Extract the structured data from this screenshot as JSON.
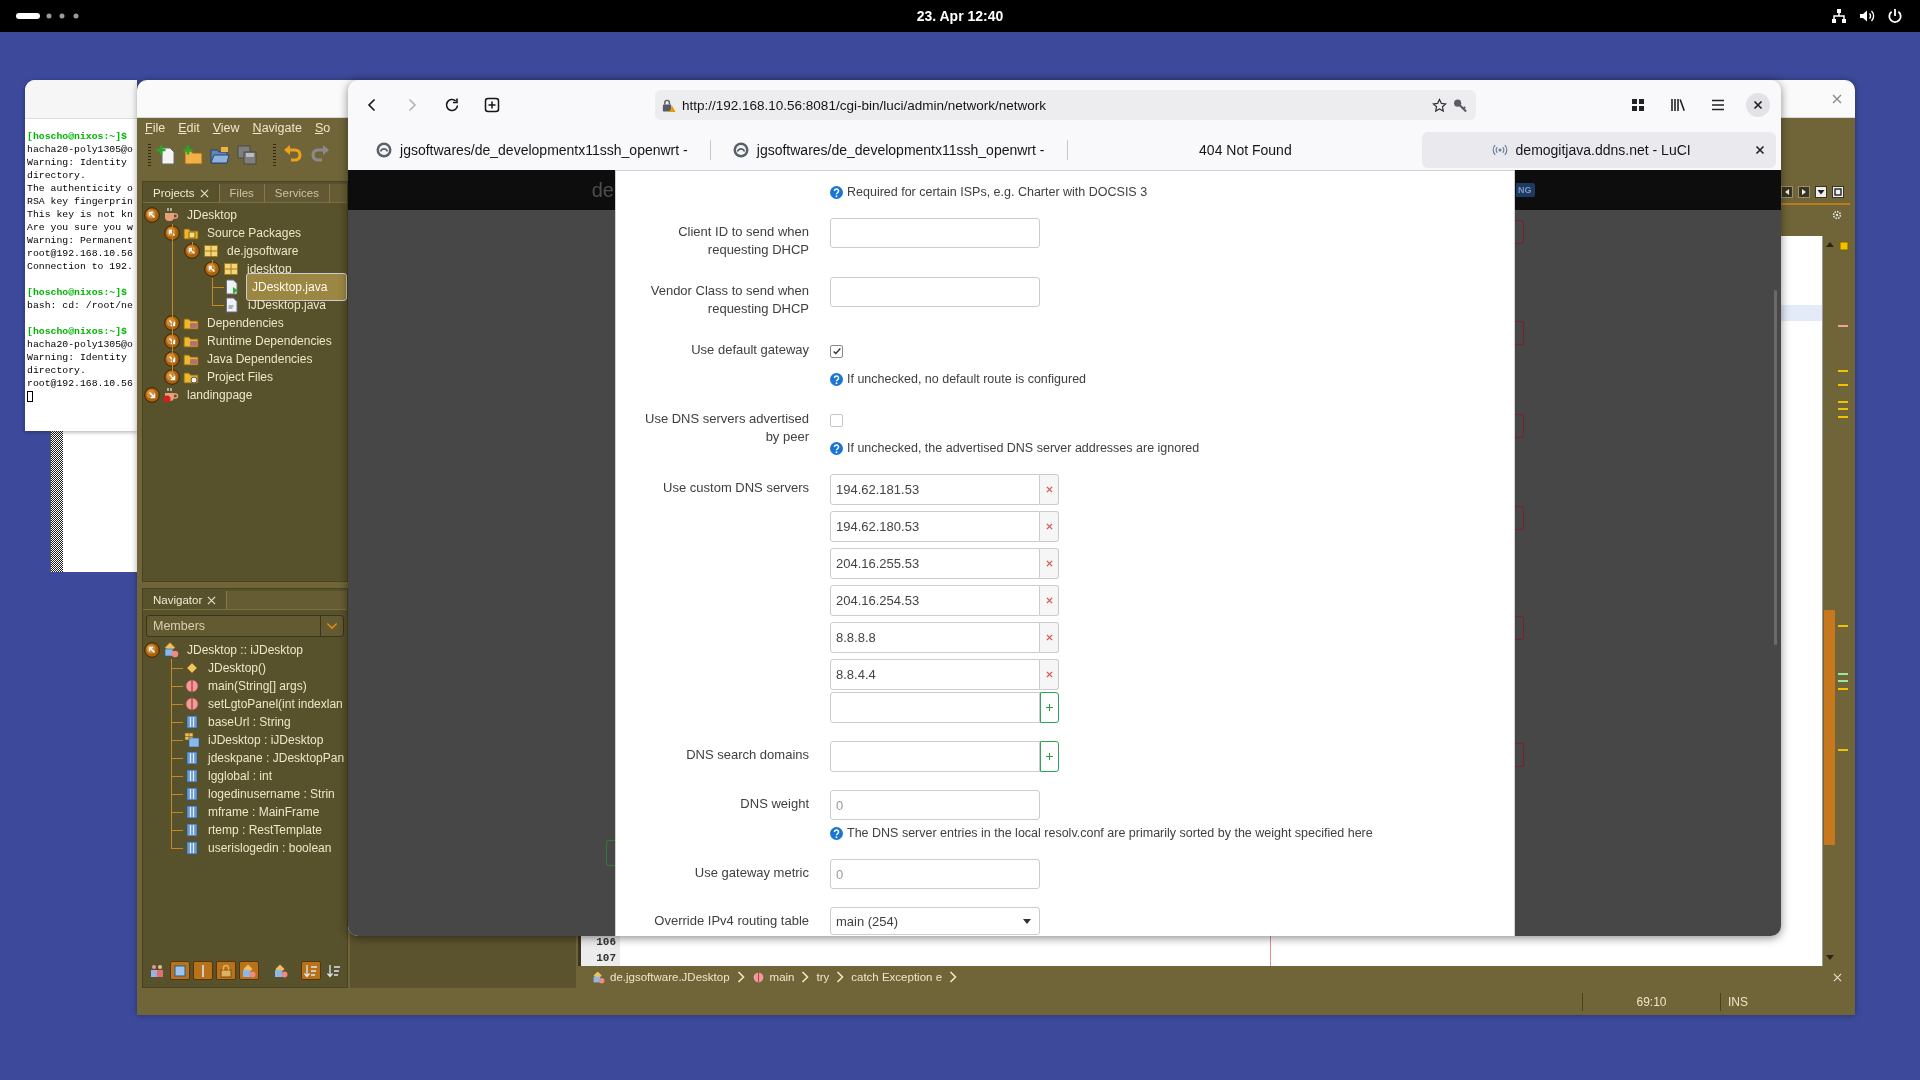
{
  "top_bar": {
    "clock": "23. Apr 12:40"
  },
  "terminal": {
    "lines": [
      {
        "kind": "prompt",
        "text": "[hoscho@nixos:~]$"
      },
      {
        "kind": "output",
        "text": "hacha20-poly1305@o"
      },
      {
        "kind": "output",
        "text": "Warning: Identity"
      },
      {
        "kind": "output",
        "text": "directory."
      },
      {
        "kind": "output",
        "text": "The authenticity o"
      },
      {
        "kind": "output",
        "text": "RSA key fingerprin"
      },
      {
        "kind": "output",
        "text": "This key is not kn"
      },
      {
        "kind": "output",
        "text": "Are you sure you w"
      },
      {
        "kind": "output",
        "text": "Warning: Permanent"
      },
      {
        "kind": "output",
        "text": "root@192.168.10.56"
      },
      {
        "kind": "output",
        "text": "Connection to 192."
      },
      {
        "kind": "blank"
      },
      {
        "kind": "prompt",
        "text": "[hoscho@nixos:~]$"
      },
      {
        "kind": "output",
        "text": "bash: cd: /root/ne"
      },
      {
        "kind": "blank"
      },
      {
        "kind": "prompt",
        "text": "[hoscho@nixos:~]$"
      },
      {
        "kind": "output",
        "text": "hacha20-poly1305@o"
      },
      {
        "kind": "output",
        "text": "Warning: Identity"
      },
      {
        "kind": "output",
        "text": "directory."
      },
      {
        "kind": "output",
        "text": "root@192.168.10.56"
      },
      {
        "kind": "cursor"
      }
    ]
  },
  "netbeans": {
    "menu": [
      "File",
      "Edit",
      "View",
      "Navigate",
      "So"
    ],
    "toolbar": [
      {
        "kind": "new-file",
        "disabled": false
      },
      {
        "kind": "new-project",
        "disabled": false
      },
      {
        "kind": "open-project",
        "disabled": false
      },
      {
        "kind": "save-all",
        "disabled": true
      },
      {
        "kind": "undo",
        "disabled": false
      },
      {
        "kind": "redo",
        "disabled": true
      }
    ],
    "projects": {
      "tabs": [
        {
          "label": "Projects",
          "selected": true
        },
        {
          "label": "Files",
          "selected": false
        },
        {
          "label": "Services",
          "selected": false
        }
      ],
      "tree": [
        {
          "label": "JDesktop",
          "kind": "project",
          "expanded": true,
          "selected": false,
          "children": [
            {
              "label": "Source Packages",
              "kind": "source-folder",
              "expanded": true,
              "selected": false,
              "children": [
                {
                  "label": "de.jgsoftware",
                  "kind": "package",
                  "expanded": true,
                  "selected": false,
                  "children": [
                    {
                      "label": "jdesktop",
                      "kind": "package",
                      "expanded": true,
                      "selected": false,
                      "children": [
                        {
                          "label": "JDesktop.java",
                          "kind": "main-file",
                          "selected": true
                        },
                        {
                          "label": "iJDesktop.java",
                          "kind": "file",
                          "selected": false
                        }
                      ]
                    }
                  ]
                }
              ]
            },
            {
              "label": "Dependencies",
              "kind": "library",
              "expanded": false,
              "selected": false
            },
            {
              "label": "Runtime Dependencies",
              "kind": "library",
              "expanded": false,
              "selected": false
            },
            {
              "label": "Java Dependencies",
              "kind": "library",
              "expanded": false,
              "selected": false
            },
            {
              "label": "Project Files",
              "kind": "config-folder",
              "expanded": false,
              "selected": false
            }
          ]
        },
        {
          "label": "landingpage",
          "kind": "error-project",
          "expanded": false,
          "selected": false
        }
      ]
    },
    "navigator": {
      "title": "Navigator",
      "filter": "Members",
      "tree": [
        {
          "label": "JDesktop :: iJDesktop",
          "kind": "class",
          "expanded": true,
          "children": [
            {
              "label": "JDesktop()",
              "kind": "constructor"
            },
            {
              "label": "main(String[] args)",
              "kind": "method"
            },
            {
              "label": "setLgtoPanel(int indexlan",
              "kind": "method"
            },
            {
              "label": "baseUrl : String",
              "kind": "field"
            },
            {
              "label": "iJDesktop : iJDesktop",
              "kind": "inner-class"
            },
            {
              "label": "jdeskpane : JDesktopPan",
              "kind": "field"
            },
            {
              "label": "lgglobal : int",
              "kind": "field"
            },
            {
              "label": "logedinusername : Strin",
              "kind": "field"
            },
            {
              "label": "mframe : MainFrame",
              "kind": "field"
            },
            {
              "label": "rtemp : RestTemplate",
              "kind": "field"
            },
            {
              "label": "userislogedin : boolean",
              "kind": "field"
            }
          ]
        }
      ],
      "filters": [
        {
          "kind": "inherited",
          "on": false
        },
        {
          "kind": "fields",
          "on": true
        },
        {
          "kind": "static",
          "on": true
        },
        {
          "kind": "non-public",
          "on": true
        },
        {
          "kind": "inner-classes",
          "on": true
        },
        {
          "kind": "fq-names",
          "on": false
        },
        {
          "kind": "sort-alpha",
          "on": true
        },
        {
          "kind": "sort-source",
          "on": false
        }
      ]
    },
    "editor": {
      "line_numbers": [
        "106",
        "107"
      ],
      "breadcrumbs": [
        {
          "label": "de.jgsoftware.JDesktop",
          "kind": "class"
        },
        {
          "label": "main",
          "kind": "method"
        },
        {
          "label": "try",
          "kind": "plain"
        },
        {
          "label": "catch Exception e",
          "kind": "plain"
        }
      ]
    },
    "status_bar": {
      "position": "69:10",
      "mode": "INS"
    }
  },
  "browser": {
    "toolbar": [
      {
        "kind": "back",
        "disabled": false
      },
      {
        "kind": "forward",
        "disabled": true
      },
      {
        "kind": "reload",
        "disabled": false
      },
      {
        "kind": "new-tab",
        "disabled": false
      }
    ],
    "url": "http://192.168.10.56:8081/cgi-bin/luci/admin/network/network",
    "tabs": [
      {
        "title": "jgsoftwares/de_developmentx11ssh_openwrt -",
        "kind": "repo",
        "selected": false
      },
      {
        "title": "jgsoftwares/de_developmentx11ssh_openwrt -",
        "kind": "repo",
        "selected": false
      },
      {
        "title": "404 Not Found",
        "kind": "none",
        "selected": false
      },
      {
        "title": "demogitjava.ddns.net - LuCI",
        "kind": "luci",
        "selected": true
      }
    ],
    "page": {
      "header_text": "de",
      "badge": "NG",
      "modal": {
        "rows": [
          {
            "kind": "note",
            "help": "Required for certain ISPs, e.g. Charter with DOCSIS 3"
          },
          {
            "kind": "text",
            "label": "Client ID to send when requesting DHCP"
          },
          {
            "kind": "text",
            "label": "Vendor Class to send when requesting DHCP"
          },
          {
            "kind": "checkbox",
            "label": "Use default gateway",
            "checked": true,
            "help": "If unchecked, no default route is configured"
          },
          {
            "kind": "checkbox",
            "label": "Use DNS servers advertised by peer",
            "checked": false,
            "help": "If unchecked, the advertised DNS server addresses are ignored"
          },
          {
            "kind": "list",
            "label": "Use custom DNS servers",
            "values": [
              "194.62.181.53",
              "194.62.180.53",
              "204.16.255.53",
              "204.16.254.53",
              "8.8.8.8",
              "8.8.4.4"
            ]
          },
          {
            "kind": "list",
            "label": "DNS search domains"
          },
          {
            "kind": "text",
            "label": "DNS weight",
            "placeholder": "0",
            "help": "The DNS server entries in the local resolv.conf are primarily sorted by the weight specified here"
          },
          {
            "kind": "text",
            "label": "Use gateway metric",
            "placeholder": "0"
          },
          {
            "kind": "select",
            "label": "Override IPv4 routing table",
            "value": "main (254)"
          }
        ]
      }
    }
  }
}
